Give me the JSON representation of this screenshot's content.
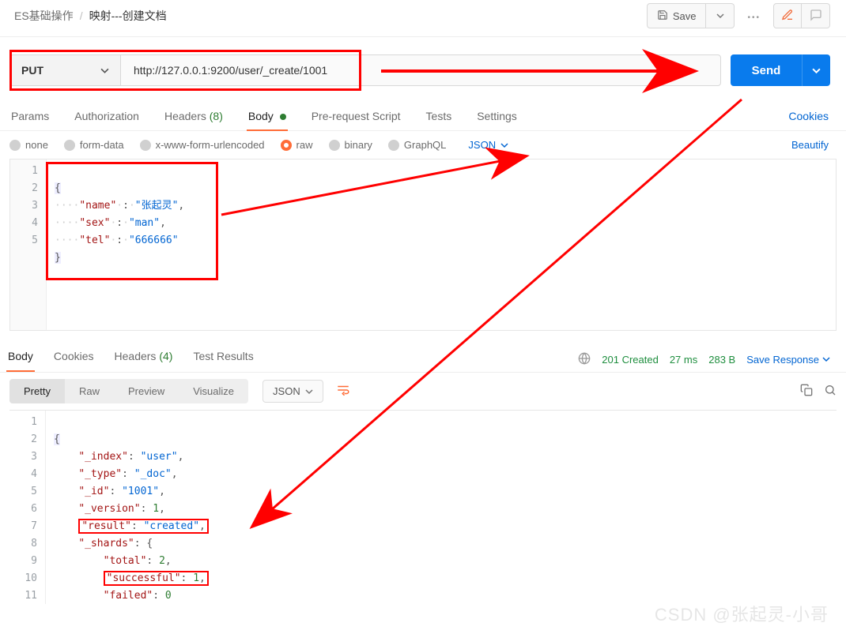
{
  "breadcrumb": {
    "root": "ES基础操作",
    "leaf": "映射---创建文档"
  },
  "top": {
    "save": "Save",
    "pencil_icon": "edit-icon",
    "comment_icon": "comment-icon"
  },
  "request": {
    "method": "PUT",
    "url": "http://127.0.0.1:9200/user/_create/1001",
    "send": "Send"
  },
  "tabs": {
    "params": "Params",
    "auth": "Authorization",
    "headers_label": "Headers",
    "headers_count": "(8)",
    "body": "Body",
    "prereq": "Pre-request Script",
    "tests": "Tests",
    "settings": "Settings",
    "cookies": "Cookies"
  },
  "body_types": {
    "none": "none",
    "form": "form-data",
    "urlenc": "x-www-form-urlencoded",
    "raw": "raw",
    "binary": "binary",
    "graphql": "GraphQL",
    "json": "JSON",
    "beautify": "Beautify"
  },
  "request_body": {
    "lines": [
      "1",
      "2",
      "3",
      "4",
      "5"
    ],
    "l1": "{",
    "l2_key": "\"name\"",
    "l2_val": "\"张起灵\"",
    "l3_key": "\"sex\"",
    "l3_val": "\"man\"",
    "l4_key": "\"tel\"",
    "l4_val": "\"666666\"",
    "l5": "}"
  },
  "response_tabs": {
    "body": "Body",
    "cookies": "Cookies",
    "headers_label": "Headers",
    "headers_count": "(4)",
    "tests": "Test Results"
  },
  "response_status": {
    "status": "201 Created",
    "time": "27 ms",
    "size": "283 B",
    "save": "Save Response"
  },
  "response_toolbar": {
    "pretty": "Pretty",
    "raw": "Raw",
    "preview": "Preview",
    "visualize": "Visualize",
    "json": "JSON"
  },
  "response_body": {
    "lines": [
      "1",
      "2",
      "3",
      "4",
      "5",
      "6",
      "7",
      "8",
      "9",
      "10",
      "11"
    ],
    "l1": "{",
    "l2_k": "\"_index\"",
    "l2_v": "\"user\"",
    "l3_k": "\"_type\"",
    "l3_v": "\"_doc\"",
    "l4_k": "\"_id\"",
    "l4_v": "\"1001\"",
    "l5_k": "\"_version\"",
    "l5_v": "1",
    "l6_k": "\"result\"",
    "l6_v": "\"created\"",
    "l7_k": "\"_shards\"",
    "l7_v": "{",
    "l8_k": "\"total\"",
    "l8_v": "2",
    "l9_k": "\"successful\"",
    "l9_v": "1",
    "l10_k": "\"failed\"",
    "l10_v": "0",
    "l11": "}"
  },
  "watermark": "CSDN @张起灵-小哥"
}
